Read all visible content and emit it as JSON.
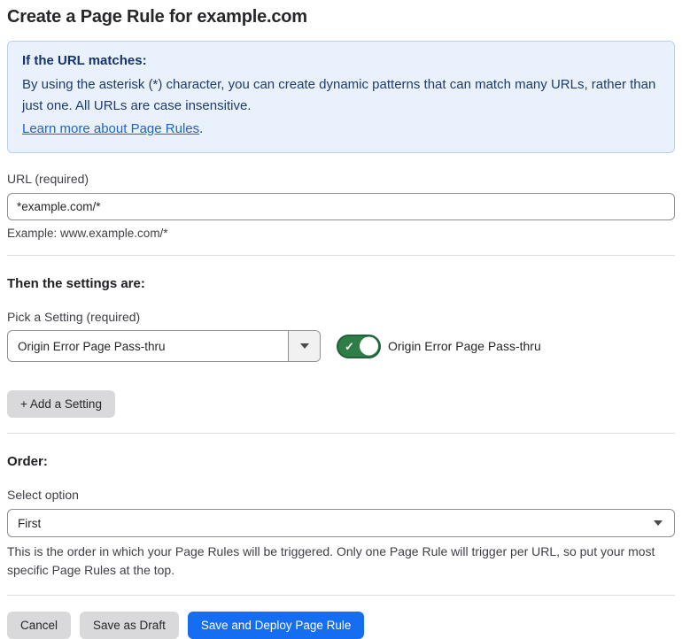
{
  "page": {
    "title": "Create a Page Rule for example.com"
  },
  "info_box": {
    "heading": "If the URL matches:",
    "body": "By using the asterisk (*) character, you can create dynamic patterns that can match many URLs, rather than just one. All URLs are case insensitive.",
    "link_label": "Learn more about Page Rules",
    "link_suffix": "."
  },
  "url_field": {
    "label": "URL (required)",
    "value": "*example.com/*",
    "helper": "Example: www.example.com/*"
  },
  "settings_section": {
    "heading": "Then the settings are:",
    "picker_label": "Pick a Setting (required)",
    "picker_value": "Origin Error Page Pass-thru",
    "toggle_state": "on",
    "toggle_check_glyph": "✓",
    "toggle_label": "Origin Error Page Pass-thru",
    "add_setting_label": "+ Add a Setting"
  },
  "order_section": {
    "heading": "Order:",
    "select_label": "Select option",
    "select_value": "First",
    "helper": "This is the order in which your Page Rules will be triggered. Only one Page Rule will trigger per URL, so put your most specific Page Rules at the top."
  },
  "footer": {
    "cancel_label": "Cancel",
    "save_draft_label": "Save as Draft",
    "save_deploy_label": "Save and Deploy Page Rule"
  },
  "colors": {
    "primary_button_blue": "#156ef2",
    "toggle_green": "#2e7d46",
    "info_box_bg": "#e8f1fc",
    "info_box_border": "#b9d3ef",
    "info_text_navy": "#1e3c6e",
    "link_blue": "#2262c9",
    "secondary_button_gray": "#d9d9db"
  },
  "icons": {
    "dropdown_caret": "triangle-down",
    "select_caret": "triangle-down",
    "toggle_check": "checkmark"
  }
}
